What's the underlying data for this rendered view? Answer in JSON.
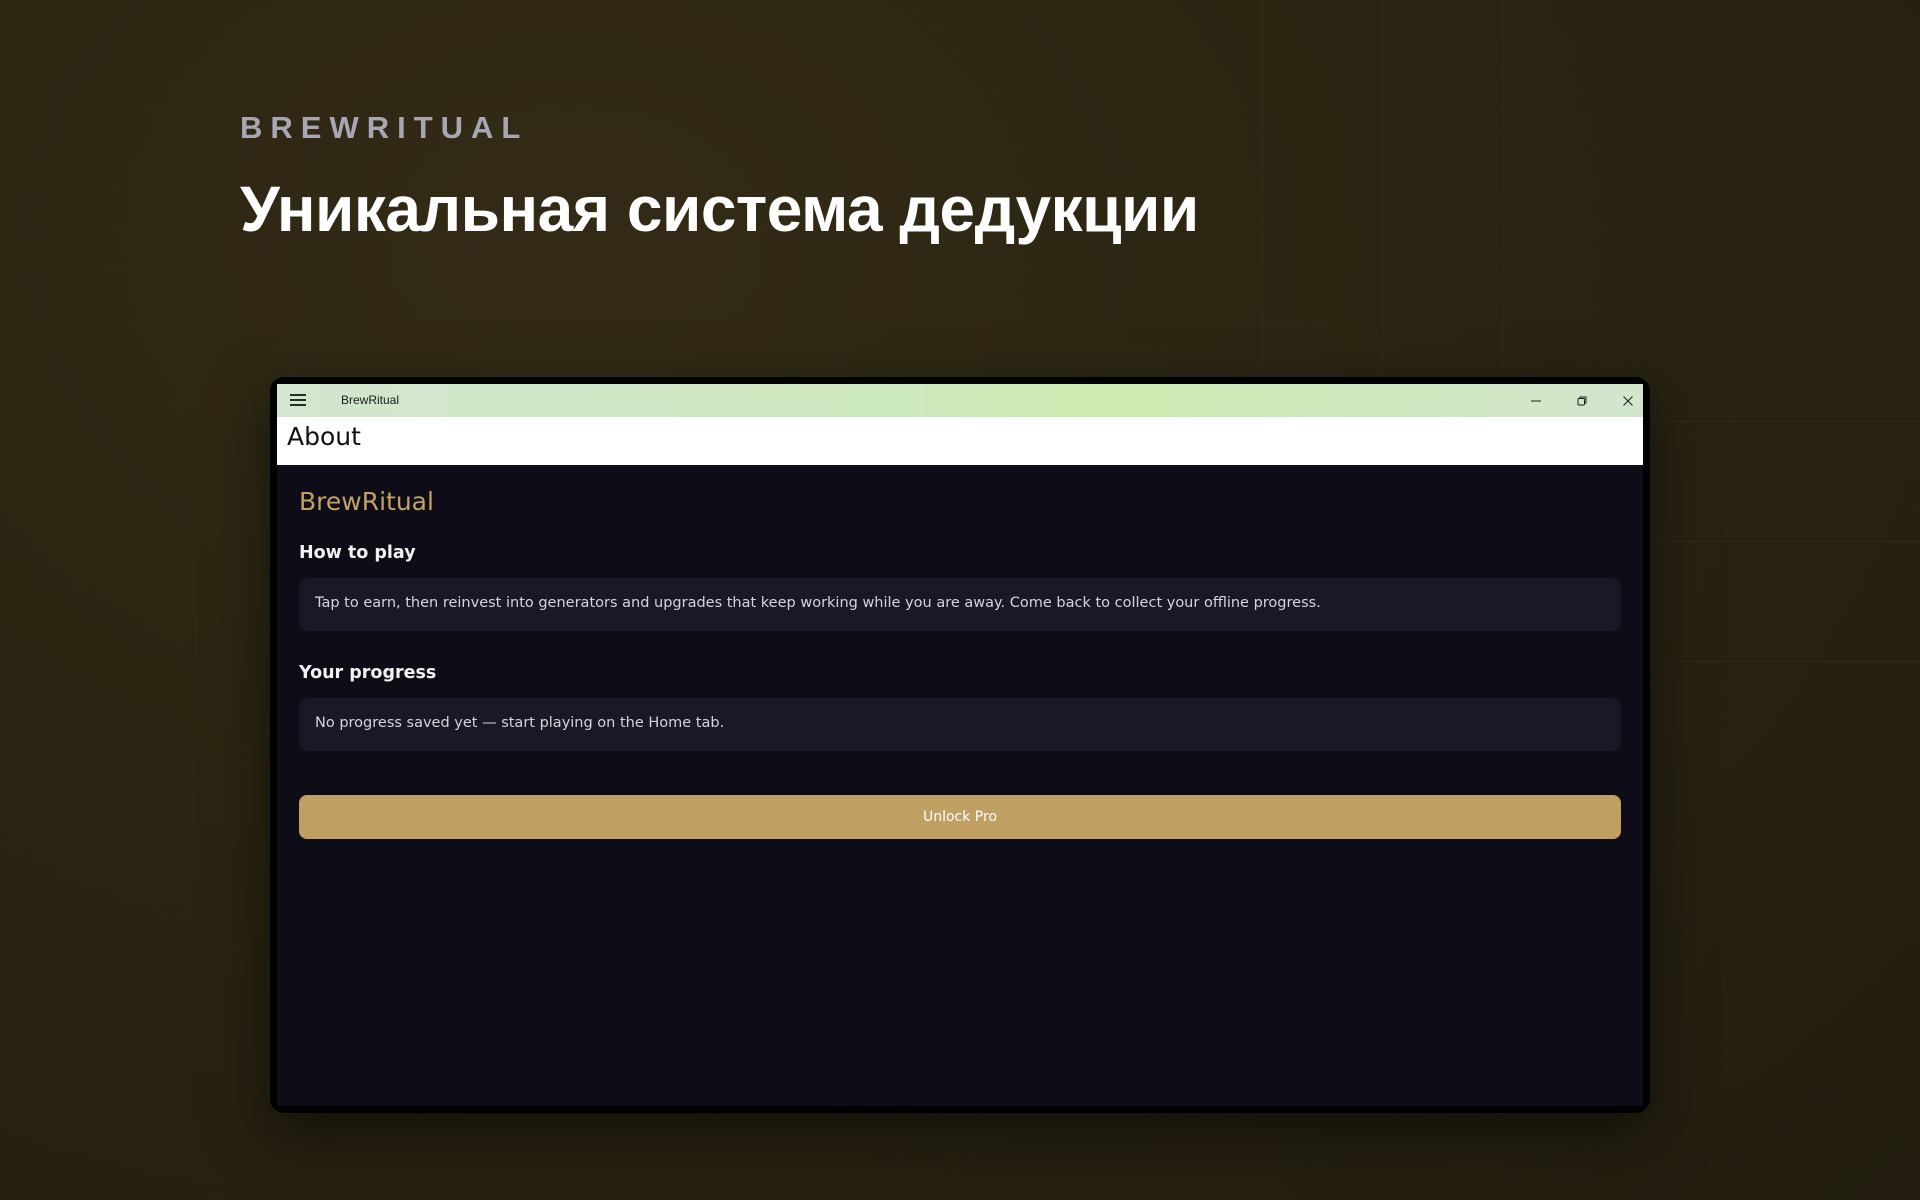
{
  "promo": {
    "brand": "BREWRITUAL",
    "headline": "Уникальная система дедукции"
  },
  "window": {
    "title": "BrewRitual",
    "controls": [
      "minimize-icon",
      "restore-icon",
      "close-icon"
    ]
  },
  "page": {
    "title": "About"
  },
  "about": {
    "app_name": "BrewRitual",
    "how_to_play_heading": "How to play",
    "how_to_play_text": "Tap to earn, then reinvest into generators and upgrades that keep working while you are away. Come back to collect your offline progress.",
    "progress_heading": "Your progress",
    "progress_text": "No progress saved yet — start playing on the Home tab.",
    "unlock_button": "Unlock Pro"
  },
  "colors": {
    "accent_gold": "#c09f62",
    "card_bg": "#1c1727",
    "window_bg": "#0e0c16"
  }
}
